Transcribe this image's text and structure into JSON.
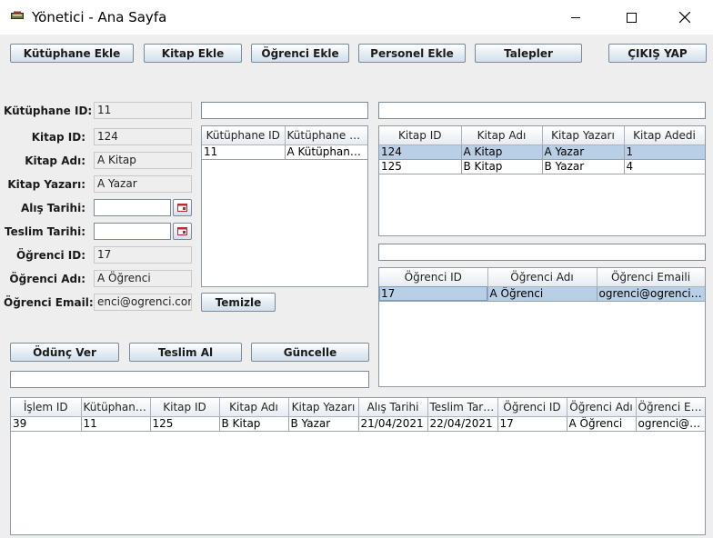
{
  "window": {
    "title": "Yönetici - Ana Sayfa",
    "minimize_icon": "minimize-icon",
    "maximize_icon": "maximize-icon",
    "close_icon": "close-icon"
  },
  "toolbar": {
    "kutuphane_ekle": "Kütüphane Ekle",
    "kitap_ekle": "Kitap Ekle",
    "ogrenci_ekle": "Öğrenci Ekle",
    "personel_ekle": "Personel Ekle",
    "talepler": "Talepler",
    "cikis_yap": "ÇIKIŞ YAP"
  },
  "form": {
    "kutuphane_id_label": "Kütüphane ID:",
    "kutuphane_id_value": "11",
    "kitap_id_label": "Kitap ID:",
    "kitap_id_value": "124",
    "kitap_adi_label": "Kitap Adı:",
    "kitap_adi_value": "A Kitap",
    "kitap_yazari_label": "Kitap Yazarı:",
    "kitap_yazari_value": "A Yazar",
    "alis_tarihi_label": "Alış Tarihi:",
    "alis_tarihi_value": "",
    "teslim_tarihi_label": "Teslim Tarihi:",
    "teslim_tarihi_value": "",
    "ogrenci_id_label": "Öğrenci ID:",
    "ogrenci_id_value": "17",
    "ogrenci_adi_label": "Öğrenci Adı:",
    "ogrenci_adi_value": "A Öğrenci",
    "ogrenci_email_label": "Öğrenci Email:",
    "ogrenci_email_value": "enci@ogrenci.com",
    "calendar_icon": "calendar-icon"
  },
  "actions": {
    "temizle": "Temizle",
    "odunc_ver": "Ödünç Ver",
    "teslim_al": "Teslim Al",
    "guncelle": "Güncelle"
  },
  "library_table": {
    "columns": [
      "Kütüphane ID",
      "Kütüphane Adı"
    ],
    "rows": [
      [
        "11",
        "A Kütüphanesi"
      ]
    ]
  },
  "book_table": {
    "columns": [
      "Kitap ID",
      "Kitap Adı",
      "Kitap Yazarı",
      "Kitap Adedi"
    ],
    "rows": [
      [
        "124",
        "A Kitap",
        "A Yazar",
        "1"
      ],
      [
        "125",
        "B Kitap",
        "B Yazar",
        "4"
      ]
    ]
  },
  "student_table": {
    "columns": [
      "Öğrenci ID",
      "Öğrenci Adı",
      "Öğrenci Emaili"
    ],
    "rows": [
      [
        "17",
        "A Öğrenci",
        "ogrenci@ogrenci.c..."
      ]
    ]
  },
  "transaction_table": {
    "columns": [
      "İşlem ID",
      "Kütüphane ...",
      "Kitap ID",
      "Kitap Adı",
      "Kitap Yazarı",
      "Alış Tarihi",
      "Teslim Tarihi",
      "Öğrenci ID",
      "Öğrenci Adı",
      "Öğrenci Em..."
    ],
    "rows": [
      [
        "39",
        "11",
        "125",
        "B Kitap",
        "B Yazar",
        "21/04/2021",
        "22/04/2021",
        "17",
        "A Öğrenci",
        "ogrenci@o..."
      ]
    ]
  },
  "search": {
    "library_search_value": "",
    "book_search_value": "",
    "student_search_value": "",
    "transaction_search_value": ""
  }
}
